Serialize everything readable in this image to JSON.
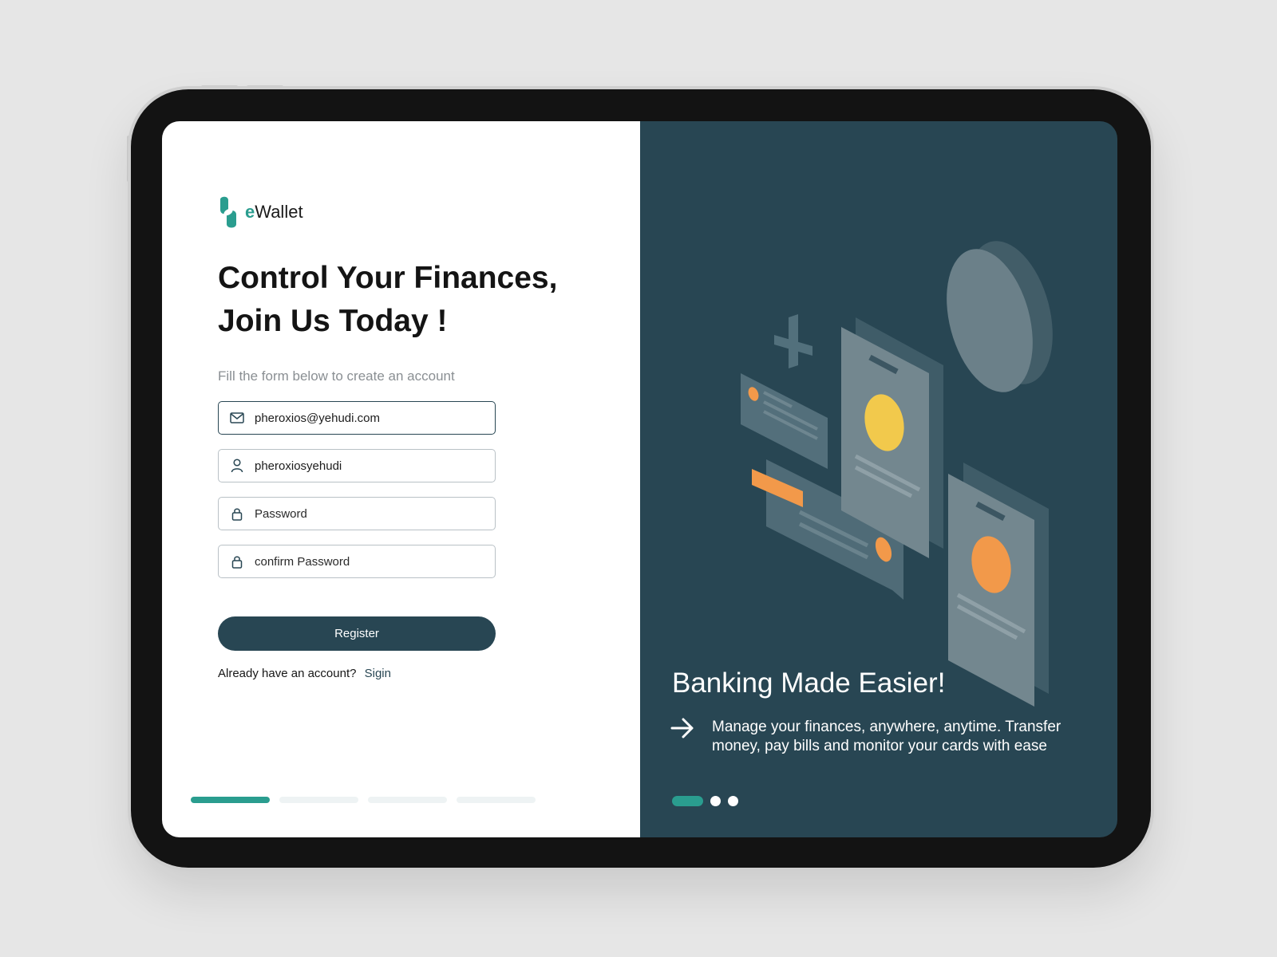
{
  "brand": {
    "prefix": "e",
    "name": "Wallet"
  },
  "form": {
    "headline": "Control  Your Finances,\nJoin Us Today !",
    "subtitle": "Fill the form below to create an account",
    "fields": [
      {
        "name": "email",
        "icon": "mail-icon",
        "value": "pheroxios@yehudi.com",
        "placeholder": ""
      },
      {
        "name": "username",
        "icon": "user-icon",
        "value": "pheroxiosyehudi",
        "placeholder": ""
      },
      {
        "name": "password",
        "icon": "lock-icon",
        "value": "",
        "placeholder": "Password"
      },
      {
        "name": "confirm_password",
        "icon": "lock-icon",
        "value": "",
        "placeholder": "confirm Password"
      }
    ],
    "register_label": "Register",
    "already_text": "Already have an account?",
    "signin_label": "Sigin",
    "progress_steps": 4,
    "progress_active": 1
  },
  "banner": {
    "title": "Banking Made Easier!",
    "text": "Manage your finances, anywhere, anytime. Transfer money, pay bills and monitor your cards with ease",
    "slides": 3,
    "active_slide": 1
  },
  "colors": {
    "primary": "#284653",
    "accent": "#2a9d8f",
    "yellow": "#f2c94c",
    "orange": "#f2994a"
  }
}
